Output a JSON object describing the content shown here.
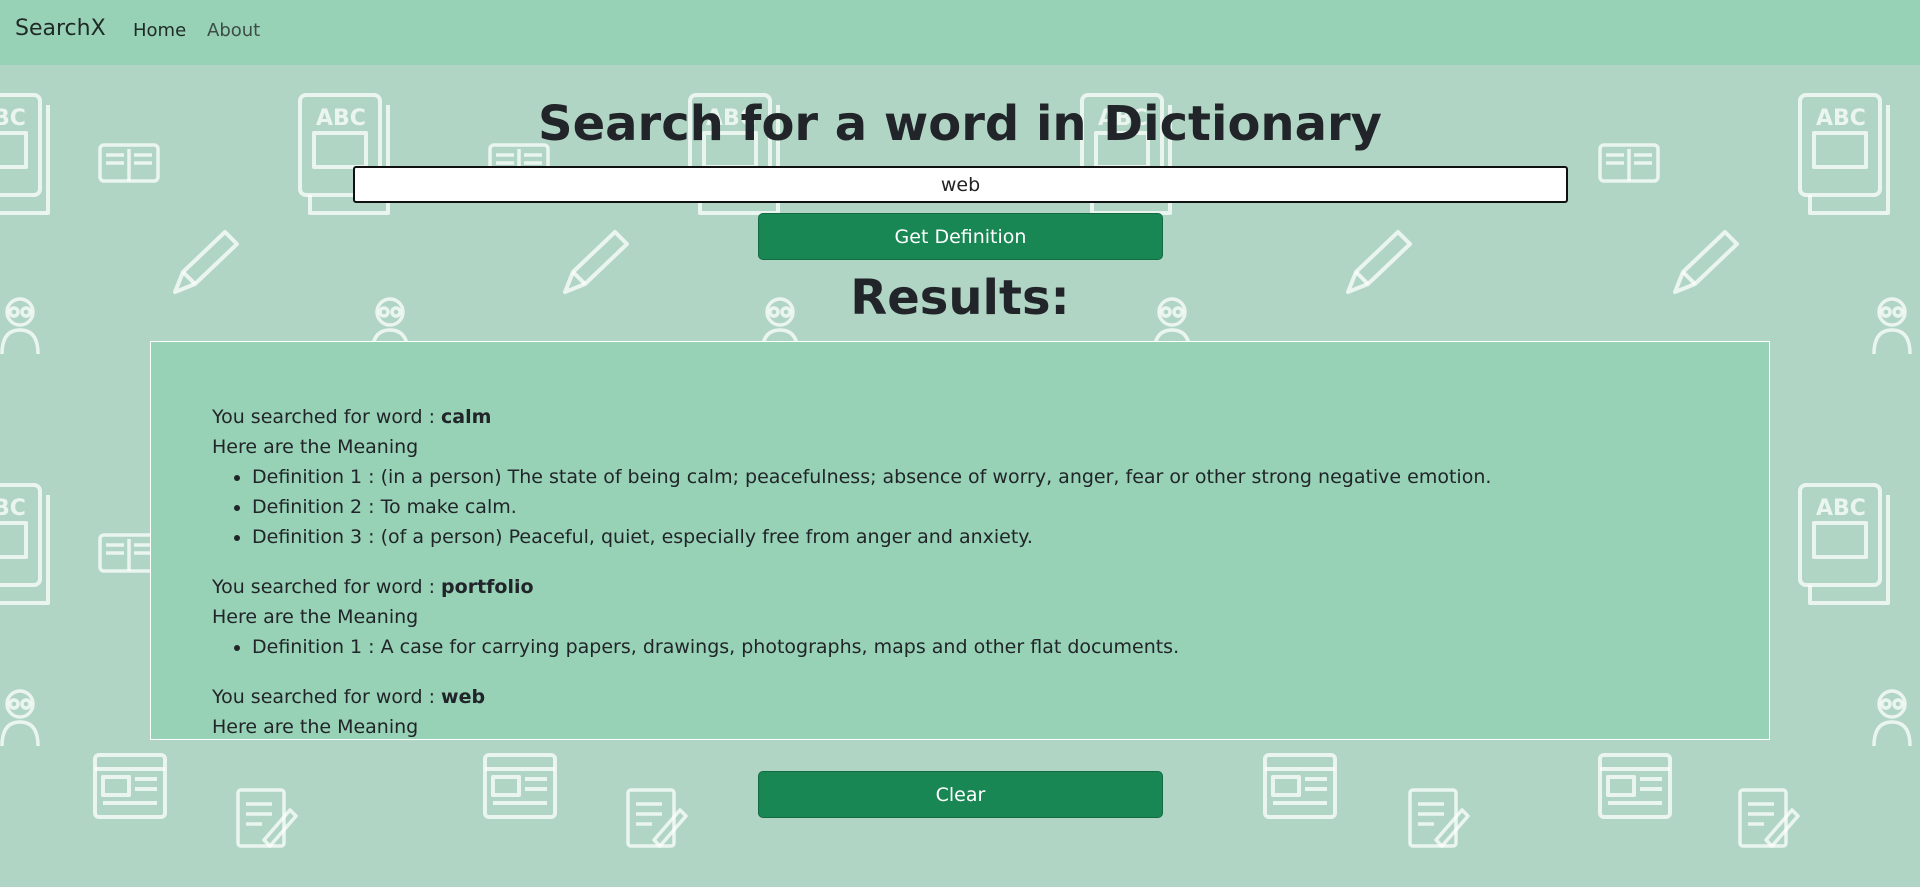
{
  "navbar": {
    "brand": "SearchX",
    "links": [
      {
        "label": "Home",
        "active": true
      },
      {
        "label": "About",
        "active": false
      }
    ]
  },
  "search": {
    "title": "Search for a word in Dictionary",
    "input_value": "web",
    "button_label": "Get Definition"
  },
  "results": {
    "title": "Results:",
    "searched_prefix": "You searched for word : ",
    "meaning_label": "Here are the Meaning",
    "entries": [
      {
        "word": "calm",
        "definitions": [
          "Definition 1 : (in a person) The state of being calm; peacefulness; absence of worry, anger, fear or other strong negative emotion.",
          "Definition 2 : To make calm.",
          "Definition 3 : (of a person) Peaceful, quiet, especially free from anger and anxiety."
        ]
      },
      {
        "word": "portfolio",
        "definitions": [
          "Definition 1 : A case for carrying papers, drawings, photographs, maps and other flat documents."
        ]
      },
      {
        "word": "web",
        "definitions": []
      }
    ]
  },
  "clear_button_label": "Clear",
  "colors": {
    "navbar": "#97d1b6",
    "page_background": "#b1d5c4",
    "results_background": "#97d1b6",
    "button": "#198754"
  },
  "background_icons": [
    "book-icon",
    "pencil-icon",
    "student-icon",
    "newspaper-icon",
    "document-icon",
    "open-book-icon"
  ]
}
